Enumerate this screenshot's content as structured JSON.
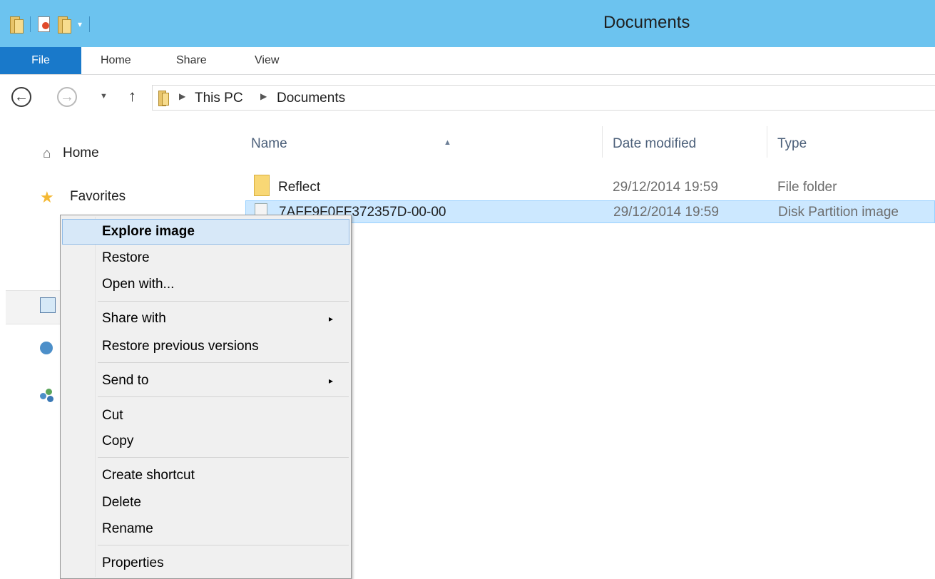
{
  "window": {
    "title": "Documents"
  },
  "ribbon": {
    "tabs": [
      "File",
      "Home",
      "Share",
      "View"
    ]
  },
  "address": {
    "crumbs": [
      "This PC",
      "Documents"
    ]
  },
  "sidebar": {
    "items": [
      {
        "label": "Home",
        "icon": "home-icon"
      },
      {
        "label": "Favorites",
        "icon": "star-icon"
      }
    ]
  },
  "filelist": {
    "columns": [
      "Name",
      "Date modified",
      "Type"
    ],
    "rows": [
      {
        "name": "Reflect",
        "date": "29/12/2014 19:59",
        "type": "File folder"
      },
      {
        "name": "7AFF9F0FF372357D-00-00",
        "date": "29/12/2014 19:59",
        "type": "Disk Partition image"
      }
    ]
  },
  "context_menu": {
    "items": [
      "Explore image",
      "Restore",
      "Open with...",
      "Share with",
      "Restore previous versions",
      "Send to",
      "Cut",
      "Copy",
      "Create shortcut",
      "Delete",
      "Rename",
      "Properties"
    ],
    "submenu_arrow": "▸"
  },
  "colors": {
    "titlebar": "#6cc3ef",
    "file_tab": "#1979ca",
    "selection": "#cce8ff",
    "menu_highlight": "#d7e8f8"
  }
}
